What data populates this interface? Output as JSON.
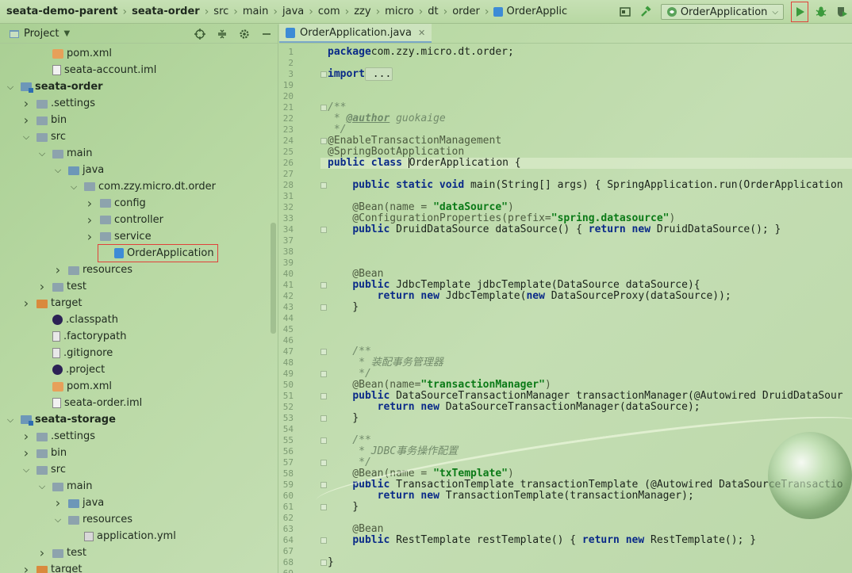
{
  "breadcrumbs": [
    "seata-demo-parent",
    "seata-order",
    "src",
    "main",
    "java",
    "com",
    "zzy",
    "micro",
    "dt",
    "order",
    "OrderApplic"
  ],
  "run_config": {
    "label": "OrderApplication"
  },
  "project_panel": {
    "title": "Project"
  },
  "tree": [
    {
      "label": "pom.xml",
      "icon": "xml-file-icon",
      "depth": 3,
      "arrow": ""
    },
    {
      "label": "seata-account.iml",
      "icon": "iml-file-icon",
      "depth": 3,
      "arrow": ""
    },
    {
      "label": "seata-order",
      "icon": "module-icon",
      "depth": 1,
      "arrow": "down",
      "bold": true
    },
    {
      "label": ".settings",
      "icon": "folder-icon",
      "depth": 2,
      "arrow": "right"
    },
    {
      "label": "bin",
      "icon": "folder-icon",
      "depth": 2,
      "arrow": "right"
    },
    {
      "label": "src",
      "icon": "folder-icon",
      "depth": 2,
      "arrow": "down"
    },
    {
      "label": "main",
      "icon": "folder-icon",
      "depth": 3,
      "arrow": "down"
    },
    {
      "label": "java",
      "icon": "source-folder-icon",
      "depth": 4,
      "arrow": "down"
    },
    {
      "label": "com.zzy.micro.dt.order",
      "icon": "package-icon",
      "depth": 5,
      "arrow": "down"
    },
    {
      "label": "config",
      "icon": "package-icon",
      "depth": 6,
      "arrow": "right"
    },
    {
      "label": "controller",
      "icon": "package-icon",
      "depth": 6,
      "arrow": "right"
    },
    {
      "label": "service",
      "icon": "package-icon",
      "depth": 6,
      "arrow": "right"
    },
    {
      "label": "OrderApplication",
      "icon": "java-class-icon",
      "depth": 7,
      "arrow": "",
      "selected": true
    },
    {
      "label": "resources",
      "icon": "folder-icon",
      "depth": 4,
      "arrow": "right"
    },
    {
      "label": "test",
      "icon": "folder-icon",
      "depth": 3,
      "arrow": "right"
    },
    {
      "label": "target",
      "icon": "orange-folder-icon",
      "depth": 2,
      "arrow": "right"
    },
    {
      "label": ".classpath",
      "icon": "eclipse-icon",
      "depth": 3,
      "arrow": ""
    },
    {
      "label": ".factorypath",
      "icon": "text-file-icon",
      "depth": 3,
      "arrow": ""
    },
    {
      "label": ".gitignore",
      "icon": "text-file-icon",
      "depth": 3,
      "arrow": ""
    },
    {
      "label": ".project",
      "icon": "eclipse-icon",
      "depth": 3,
      "arrow": ""
    },
    {
      "label": "pom.xml",
      "icon": "xml-file-icon",
      "depth": 3,
      "arrow": ""
    },
    {
      "label": "seata-order.iml",
      "icon": "iml-file-icon",
      "depth": 3,
      "arrow": ""
    },
    {
      "label": "seata-storage",
      "icon": "module-icon",
      "depth": 1,
      "arrow": "down",
      "bold": true
    },
    {
      "label": ".settings",
      "icon": "folder-icon",
      "depth": 2,
      "arrow": "right"
    },
    {
      "label": "bin",
      "icon": "folder-icon",
      "depth": 2,
      "arrow": "right"
    },
    {
      "label": "src",
      "icon": "folder-icon",
      "depth": 2,
      "arrow": "down"
    },
    {
      "label": "main",
      "icon": "folder-icon",
      "depth": 3,
      "arrow": "down"
    },
    {
      "label": "java",
      "icon": "source-folder-icon",
      "depth": 4,
      "arrow": "right"
    },
    {
      "label": "resources",
      "icon": "folder-icon",
      "depth": 4,
      "arrow": "down"
    },
    {
      "label": "application.yml",
      "icon": "yml-file-icon",
      "depth": 5,
      "arrow": ""
    },
    {
      "label": "test",
      "icon": "folder-icon",
      "depth": 3,
      "arrow": "right"
    },
    {
      "label": "target",
      "icon": "orange-folder-icon",
      "depth": 2,
      "arrow": "right"
    }
  ],
  "editor": {
    "tab_label": "OrderApplication.java",
    "lines": [
      {
        "n": "1",
        "segs": [
          [
            "kw",
            "package"
          ],
          [
            "",
            "com.zzy.micro.dt.order;"
          ]
        ]
      },
      {
        "n": "2",
        "segs": []
      },
      {
        "n": "3",
        "segs": [
          [
            "kw",
            "import"
          ],
          [
            "fold",
            " ..."
          ]
        ]
      },
      {
        "n": "19",
        "segs": []
      },
      {
        "n": "20",
        "segs": []
      },
      {
        "n": "21",
        "segs": [
          [
            "cm",
            "/**"
          ]
        ]
      },
      {
        "n": "22",
        "segs": [
          [
            "cm",
            " * "
          ],
          [
            "tag",
            "@author"
          ],
          [
            "cm",
            " guokaige"
          ]
        ]
      },
      {
        "n": "23",
        "segs": [
          [
            "cm",
            " */"
          ]
        ]
      },
      {
        "n": "24",
        "segs": [
          [
            "ann",
            "@EnableTransactionManagement"
          ]
        ]
      },
      {
        "n": "25",
        "segs": [
          [
            "ann",
            "@SpringBootApplication"
          ]
        ]
      },
      {
        "n": "26",
        "segs": [
          [
            "kw",
            "public class "
          ],
          [
            "caret",
            ""
          ],
          [
            "",
            "OrderApplication {"
          ]
        ],
        "current": true
      },
      {
        "n": "27",
        "segs": []
      },
      {
        "n": "28",
        "segs": [
          [
            "",
            "    "
          ],
          [
            "kw",
            "public static void "
          ],
          [
            "",
            "main(String[] args) { SpringApplication.run(OrderApplication"
          ]
        ]
      },
      {
        "n": "31",
        "segs": []
      },
      {
        "n": "32",
        "segs": [
          [
            "ann",
            "    @Bean(name = "
          ],
          [
            "str",
            "\"dataSource\""
          ],
          [
            "ann",
            ")"
          ]
        ]
      },
      {
        "n": "33",
        "segs": [
          [
            "ann",
            "    @ConfigurationProperties(prefix="
          ],
          [
            "str",
            "\"spring.datasource\""
          ],
          [
            "ann",
            ")"
          ]
        ]
      },
      {
        "n": "34",
        "segs": [
          [
            "",
            "    "
          ],
          [
            "kw",
            "public "
          ],
          [
            "",
            "DruidDataSource dataSource() { "
          ],
          [
            "kw",
            "return new "
          ],
          [
            "",
            "DruidDataSource(); }"
          ]
        ]
      },
      {
        "n": "37",
        "segs": []
      },
      {
        "n": "38",
        "segs": []
      },
      {
        "n": "39",
        "segs": []
      },
      {
        "n": "40",
        "segs": [
          [
            "ann",
            "    @Bean"
          ]
        ]
      },
      {
        "n": "41",
        "segs": [
          [
            "",
            "    "
          ],
          [
            "kw",
            "public "
          ],
          [
            "",
            "JdbcTemplate jdbcTemplate(DataSource dataSource){"
          ]
        ]
      },
      {
        "n": "42",
        "segs": [
          [
            "",
            "        "
          ],
          [
            "kw",
            "return new "
          ],
          [
            "",
            "JdbcTemplate("
          ],
          [
            "kw",
            "new "
          ],
          [
            "",
            "DataSourceProxy(dataSource));"
          ]
        ]
      },
      {
        "n": "43",
        "segs": [
          [
            "",
            "    }"
          ]
        ]
      },
      {
        "n": "44",
        "segs": []
      },
      {
        "n": "45",
        "segs": []
      },
      {
        "n": "46",
        "segs": []
      },
      {
        "n": "47",
        "segs": [
          [
            "cm",
            "    /**"
          ]
        ]
      },
      {
        "n": "48",
        "segs": [
          [
            "cm",
            "     * 装配事务管理器"
          ]
        ]
      },
      {
        "n": "49",
        "segs": [
          [
            "cm",
            "     */"
          ]
        ]
      },
      {
        "n": "50",
        "segs": [
          [
            "ann",
            "    @Bean(name="
          ],
          [
            "str",
            "\"transactionManager\""
          ],
          [
            "ann",
            ")"
          ]
        ]
      },
      {
        "n": "51",
        "segs": [
          [
            "",
            "    "
          ],
          [
            "kw",
            "public "
          ],
          [
            "",
            "DataSourceTransactionManager transactionManager(@Autowired DruidDataSour"
          ]
        ]
      },
      {
        "n": "52",
        "segs": [
          [
            "",
            "        "
          ],
          [
            "kw",
            "return new "
          ],
          [
            "",
            "DataSourceTransactionManager(dataSource);"
          ]
        ]
      },
      {
        "n": "53",
        "segs": [
          [
            "",
            "    }"
          ]
        ]
      },
      {
        "n": "54",
        "segs": []
      },
      {
        "n": "55",
        "segs": [
          [
            "cm",
            "    /**"
          ]
        ]
      },
      {
        "n": "56",
        "segs": [
          [
            "cm",
            "     * JDBC事务操作配置"
          ]
        ]
      },
      {
        "n": "57",
        "segs": [
          [
            "cm",
            "     */"
          ]
        ]
      },
      {
        "n": "58",
        "segs": [
          [
            "ann",
            "    @Bean(name = "
          ],
          [
            "str",
            "\"txTemplate\""
          ],
          [
            "ann",
            ")"
          ]
        ]
      },
      {
        "n": "59",
        "segs": [
          [
            "",
            "    "
          ],
          [
            "kw",
            "public "
          ],
          [
            "",
            "TransactionTemplate transactionTemplate (@Autowired DataSourceTransactio"
          ]
        ]
      },
      {
        "n": "60",
        "segs": [
          [
            "",
            "        "
          ],
          [
            "kw",
            "return new "
          ],
          [
            "",
            "TransactionTemplate(transactionManager);"
          ]
        ]
      },
      {
        "n": "61",
        "segs": [
          [
            "",
            "    }"
          ]
        ]
      },
      {
        "n": "62",
        "segs": []
      },
      {
        "n": "63",
        "segs": [
          [
            "ann",
            "    @Bean"
          ]
        ]
      },
      {
        "n": "64",
        "segs": [
          [
            "",
            "    "
          ],
          [
            "kw",
            "public "
          ],
          [
            "",
            "RestTemplate restTemplate() { "
          ],
          [
            "kw",
            "return new "
          ],
          [
            "",
            "RestTemplate(); }"
          ]
        ]
      },
      {
        "n": "67",
        "segs": []
      },
      {
        "n": "68",
        "segs": [
          [
            "",
            "}"
          ]
        ]
      },
      {
        "n": "69",
        "segs": []
      }
    ]
  },
  "colors": {
    "accent_red": "#e0413a",
    "run_green": "#3c9a3c",
    "keyword": "#0a2a88",
    "string": "#0b7a17"
  }
}
